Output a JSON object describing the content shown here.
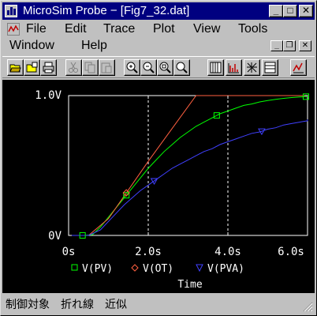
{
  "window": {
    "title": "MicroSim Probe − [Fig7_32.dat]",
    "minimize_label": "_",
    "maximize_label": "□",
    "close_label": "✕"
  },
  "menu": {
    "items": [
      "File",
      "Edit",
      "Trace",
      "Plot",
      "View",
      "Tools",
      "Window",
      "Help"
    ],
    "mdi_minimize": "_",
    "mdi_restore": "❐",
    "mdi_close": "✕"
  },
  "toolbar": {
    "icons": [
      "open-icon",
      "open-folder-icon",
      "print-icon",
      "cut-icon",
      "copy-icon",
      "paste-icon",
      "zoom-in-icon",
      "zoom-out-icon",
      "zoom-area-icon",
      "zoom-fit-icon",
      "display-icon",
      "fft-icon",
      "axis-icon",
      "table-icon",
      "cursor-icon"
    ]
  },
  "chart_data": {
    "type": "line",
    "xlabel": "Time",
    "ylabel": "",
    "xlim": [
      0,
      6
    ],
    "ylim": [
      0,
      1
    ],
    "x_ticks": [
      "0s",
      "2.0s",
      "4.0s",
      "6.0s"
    ],
    "y_ticks": [
      "0V",
      "1.0V"
    ],
    "grid": true,
    "legend_position": "bottom",
    "series": [
      {
        "name": "V(PV)",
        "color": "#00ff00",
        "marker": "square",
        "x": [
          0.0,
          0.2,
          0.4,
          0.6,
          0.8,
          1.0,
          1.2,
          1.4,
          1.6,
          1.8,
          2.0,
          2.2,
          2.4,
          2.6,
          2.8,
          3.0,
          3.2,
          3.4,
          3.6,
          3.8,
          4.0,
          4.2,
          4.4,
          4.6,
          4.8,
          5.0,
          5.2,
          5.4,
          5.6,
          5.8,
          6.0,
          6.2
        ],
        "y": [
          0.0,
          0.0,
          0.0,
          0.005,
          0.06,
          0.13,
          0.2,
          0.27,
          0.34,
          0.41,
          0.48,
          0.54,
          0.6,
          0.65,
          0.7,
          0.74,
          0.78,
          0.81,
          0.84,
          0.87,
          0.89,
          0.91,
          0.93,
          0.94,
          0.955,
          0.965,
          0.973,
          0.98,
          0.986,
          0.99,
          0.993,
          0.995
        ],
        "markers_x": [
          0.35,
          1.45,
          3.72,
          5.96
        ]
      },
      {
        "name": "V(OT)",
        "color": "#ff6040",
        "marker": "diamond",
        "x": [
          0.0,
          0.5,
          1.0,
          2.0,
          3.2,
          6.2
        ],
        "y": [
          0.0,
          0.0,
          0.12,
          0.53,
          1.0,
          1.0
        ],
        "markers_x": [
          1.45
        ]
      },
      {
        "name": "V(PVA)",
        "color": "#4040ff",
        "marker": "triangle",
        "x": [
          0.0,
          0.5,
          0.8,
          1.0,
          1.2,
          1.4,
          1.6,
          1.8,
          2.0,
          2.2,
          2.4,
          2.6,
          2.8,
          3.0,
          3.2,
          3.4,
          3.6,
          3.8,
          4.0,
          4.2,
          4.4,
          4.6,
          4.8,
          5.0,
          5.2,
          5.4,
          5.6,
          5.8,
          6.0,
          6.2
        ],
        "y": [
          0.0,
          0.0,
          0.04,
          0.1,
          0.16,
          0.22,
          0.27,
          0.32,
          0.36,
          0.4,
          0.44,
          0.48,
          0.51,
          0.54,
          0.57,
          0.6,
          0.62,
          0.65,
          0.67,
          0.69,
          0.71,
          0.73,
          0.74,
          0.76,
          0.77,
          0.79,
          0.8,
          0.81,
          0.82,
          0.83
        ],
        "markers_x": [
          2.15,
          4.85
        ]
      }
    ]
  },
  "status": {
    "text": "制御対象　折れ線　近似"
  }
}
